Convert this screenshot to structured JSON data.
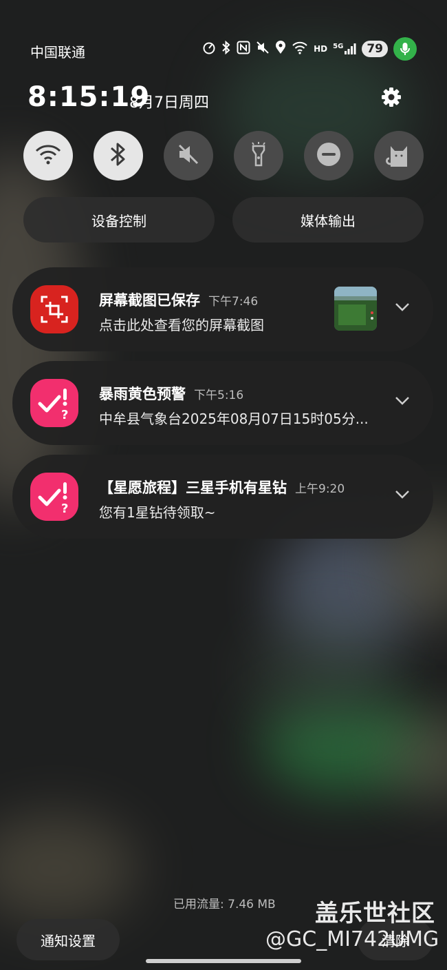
{
  "status_bar": {
    "carrier": "中国联通",
    "network_hd": "HD",
    "network_gen": "5G",
    "battery": "79",
    "icons": [
      "speed-icon",
      "bluetooth-icon",
      "nfc-icon",
      "mute-icon",
      "location-icon",
      "wifi-icon",
      "signal-icon",
      "microphone-icon"
    ]
  },
  "header": {
    "time": "8:15:19",
    "date": "8月7日周四"
  },
  "quick_settings": [
    {
      "name": "wifi",
      "state": "on",
      "icon": "wifi-icon"
    },
    {
      "name": "bluetooth",
      "state": "on",
      "icon": "bluetooth-icon"
    },
    {
      "name": "sound",
      "state": "off",
      "icon": "mute-icon"
    },
    {
      "name": "flashlight",
      "state": "off",
      "icon": "flashlight-icon"
    },
    {
      "name": "do-not-disturb",
      "state": "off",
      "icon": "minus-circle-icon"
    },
    {
      "name": "cat",
      "state": "off",
      "icon": "cat-icon"
    }
  ],
  "controls": {
    "device_control": "设备控制",
    "media_output": "媒体输出"
  },
  "notifications": [
    {
      "title": "屏幕截图已保存",
      "time": "下午7:46",
      "body": "点击此处查看您的屏幕截图",
      "icon": "screenshot-icon",
      "color": "#d8231f"
    },
    {
      "title": "暴雨黄色预警",
      "time": "下午5:16",
      "body": "中牟县气象台2025年08月07日15时05分...",
      "icon": "task-check-icon",
      "color": "#f22f6e"
    },
    {
      "title": "【星愿旅程】三星手机有星钻",
      "time": "上午9:20",
      "body": "您有1星钻待领取~",
      "icon": "task-check-icon",
      "color": "#f22f6e"
    }
  ],
  "footer": {
    "data_usage": "已用流量: 7.46 MB",
    "notification_settings": "通知设置",
    "clear": "清除"
  },
  "watermark": {
    "line1": "盖乐世社区",
    "line2": "@GC_MI742UMG"
  }
}
